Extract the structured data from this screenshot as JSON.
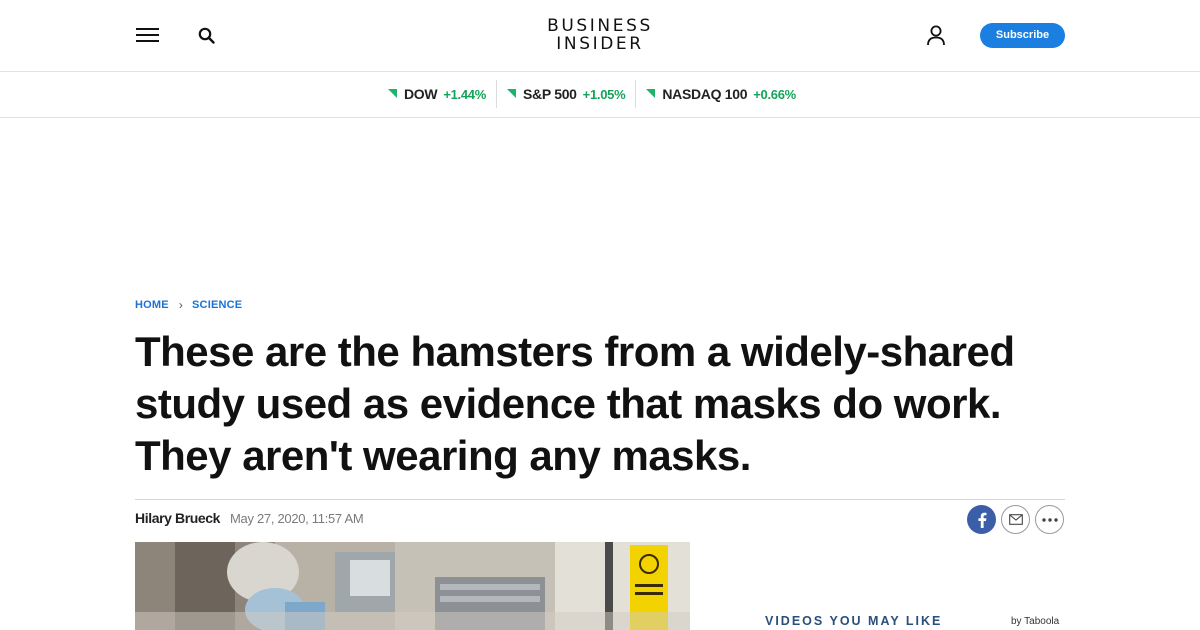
{
  "header": {
    "logo_line1": "BUSINESS",
    "logo_line2": "INSIDER",
    "subscribe_label": "Subscribe"
  },
  "ticker": [
    {
      "name": "DOW",
      "change": "+1.44%"
    },
    {
      "name": "S&P 500",
      "change": "+1.05%"
    },
    {
      "name": "NASDAQ 100",
      "change": "+0.66%"
    }
  ],
  "icons": {
    "menu": "hamburger-menu-icon",
    "search": "search-icon",
    "user": "user-icon",
    "facebook": "facebook-icon",
    "mail": "mail-icon",
    "more": "more-dots-icon",
    "breadcrumb_sep": "chevron-right-icon"
  },
  "colors": {
    "accent": "#1a7fe0",
    "link": "#1a73d4",
    "ticker_up": "#15a35a",
    "facebook": "#3b5ea8",
    "videos_title": "#2a4f7a"
  },
  "breadcrumb": {
    "home": "HOME",
    "section": "SCIENCE",
    "separator": "›"
  },
  "article": {
    "title": "These are the hamsters from a widely-shared study used as evidence that masks do work. They aren't wearing any masks.",
    "author": "Hilary Brueck",
    "date": "May 27, 2020, 11:57 AM"
  },
  "sidebar": {
    "videos_title": "VIDEOS YOU MAY LIKE",
    "sponsor": "by Taboola"
  }
}
